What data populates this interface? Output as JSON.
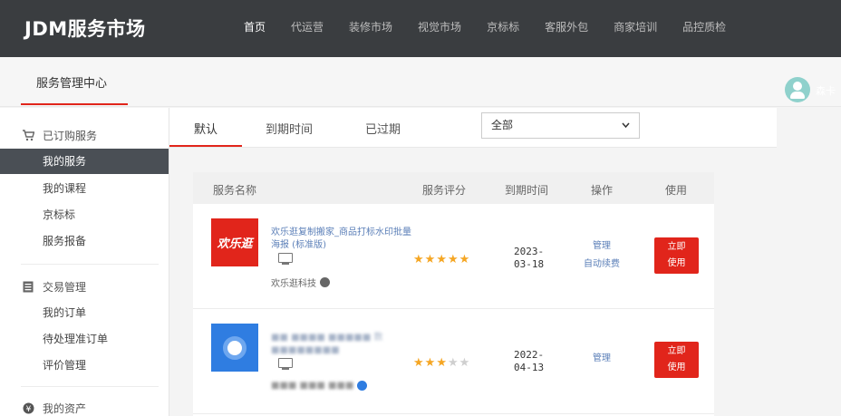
{
  "app": {
    "logo": "JDM服务市场"
  },
  "nav": {
    "items": [
      {
        "label": "首页",
        "active": true
      },
      {
        "label": "代运营"
      },
      {
        "label": "装修市场"
      },
      {
        "label": "视觉市场"
      },
      {
        "label": "京标标"
      },
      {
        "label": "客服外包"
      },
      {
        "label": "商家培训"
      },
      {
        "label": "品控质检"
      }
    ]
  },
  "subheader": {
    "title": "服务管理中心",
    "username": "森卡"
  },
  "sidebar": {
    "groups": [
      {
        "title": "已订购服务",
        "icon": "cart-icon",
        "items": [
          "我的服务",
          "我的课程",
          "京标标",
          "服务报备"
        ]
      },
      {
        "title": "交易管理",
        "icon": "list-icon",
        "items": [
          "我的订单",
          "待处理准订单",
          "评价管理"
        ]
      },
      {
        "title": "我的资产",
        "icon": "yen-icon",
        "items": []
      }
    ],
    "active_item": "我的服务"
  },
  "tabs": {
    "items": [
      "默认",
      "到期时间",
      "已过期"
    ],
    "active": "默认"
  },
  "filter": {
    "selected": "全部"
  },
  "table": {
    "headers": [
      "服务名称",
      "服务评分",
      "到期时间",
      "操作",
      "使用"
    ],
    "rows": [
      {
        "thumb_text": "欢乐逛",
        "thumb_color": "#e1251b",
        "name": "欢乐逛复制搬家_商品打标水印批量海报 (标准版)",
        "vendor": "欢乐逛科技",
        "rating": 5,
        "expire_line1": "2023-",
        "expire_line2": "03-18",
        "ops": [
          "管理",
          "自动续费"
        ],
        "use_label_1": "立即",
        "use_label_2": "使用"
      },
      {
        "thumb_text": "",
        "thumb_color": "#2f7de1",
        "name": "■■ ■■■■ ■■■■■ 数 ■■■■■■■■",
        "vendor": "■■■ ■■■ ■■■",
        "rating": 3,
        "expire_line1": "2022-",
        "expire_line2": "04-13",
        "ops": [
          "管理"
        ],
        "use_label_1": "立即",
        "use_label_2": "使用"
      }
    ]
  },
  "colors": {
    "topbar": "#3a3d40",
    "accent": "#e1251b",
    "link": "#5b7fb8",
    "star": "#f5a623"
  }
}
